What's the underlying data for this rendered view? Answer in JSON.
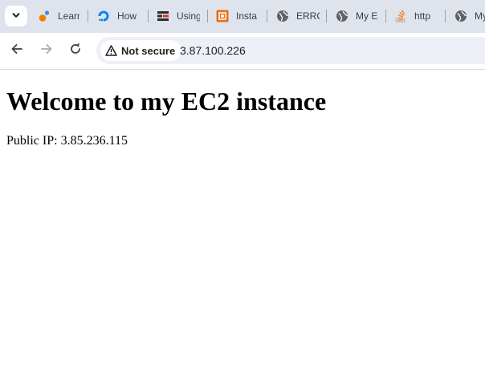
{
  "tabs": [
    {
      "label": "Learn",
      "icon": "learn-favicon"
    },
    {
      "label": "How",
      "icon": "digitalocean-favicon"
    },
    {
      "label": "Using",
      "icon": "using-favicon"
    },
    {
      "label": "Insta",
      "icon": "aws-favicon"
    },
    {
      "label": "ERRC",
      "icon": "globe-icon"
    },
    {
      "label": "My E",
      "icon": "globe-icon"
    },
    {
      "label": "http",
      "icon": "stackoverflow-favicon"
    },
    {
      "label": "My",
      "icon": "globe-icon"
    }
  ],
  "omnibox": {
    "security_label": "Not secure",
    "url": "3.87.100.226"
  },
  "page": {
    "heading": "Welcome to my EC2 instance",
    "public_ip_line": "Public IP: 3.85.236.115"
  },
  "colors": {
    "tabstrip_bg": "#dfe3eb",
    "omnibox_bg": "#edf0f6",
    "learn_icon_orange": "#f57c00",
    "do_blue": "#0080ff",
    "aws_orange": "#e8711a",
    "so_orange": "#f48024"
  }
}
